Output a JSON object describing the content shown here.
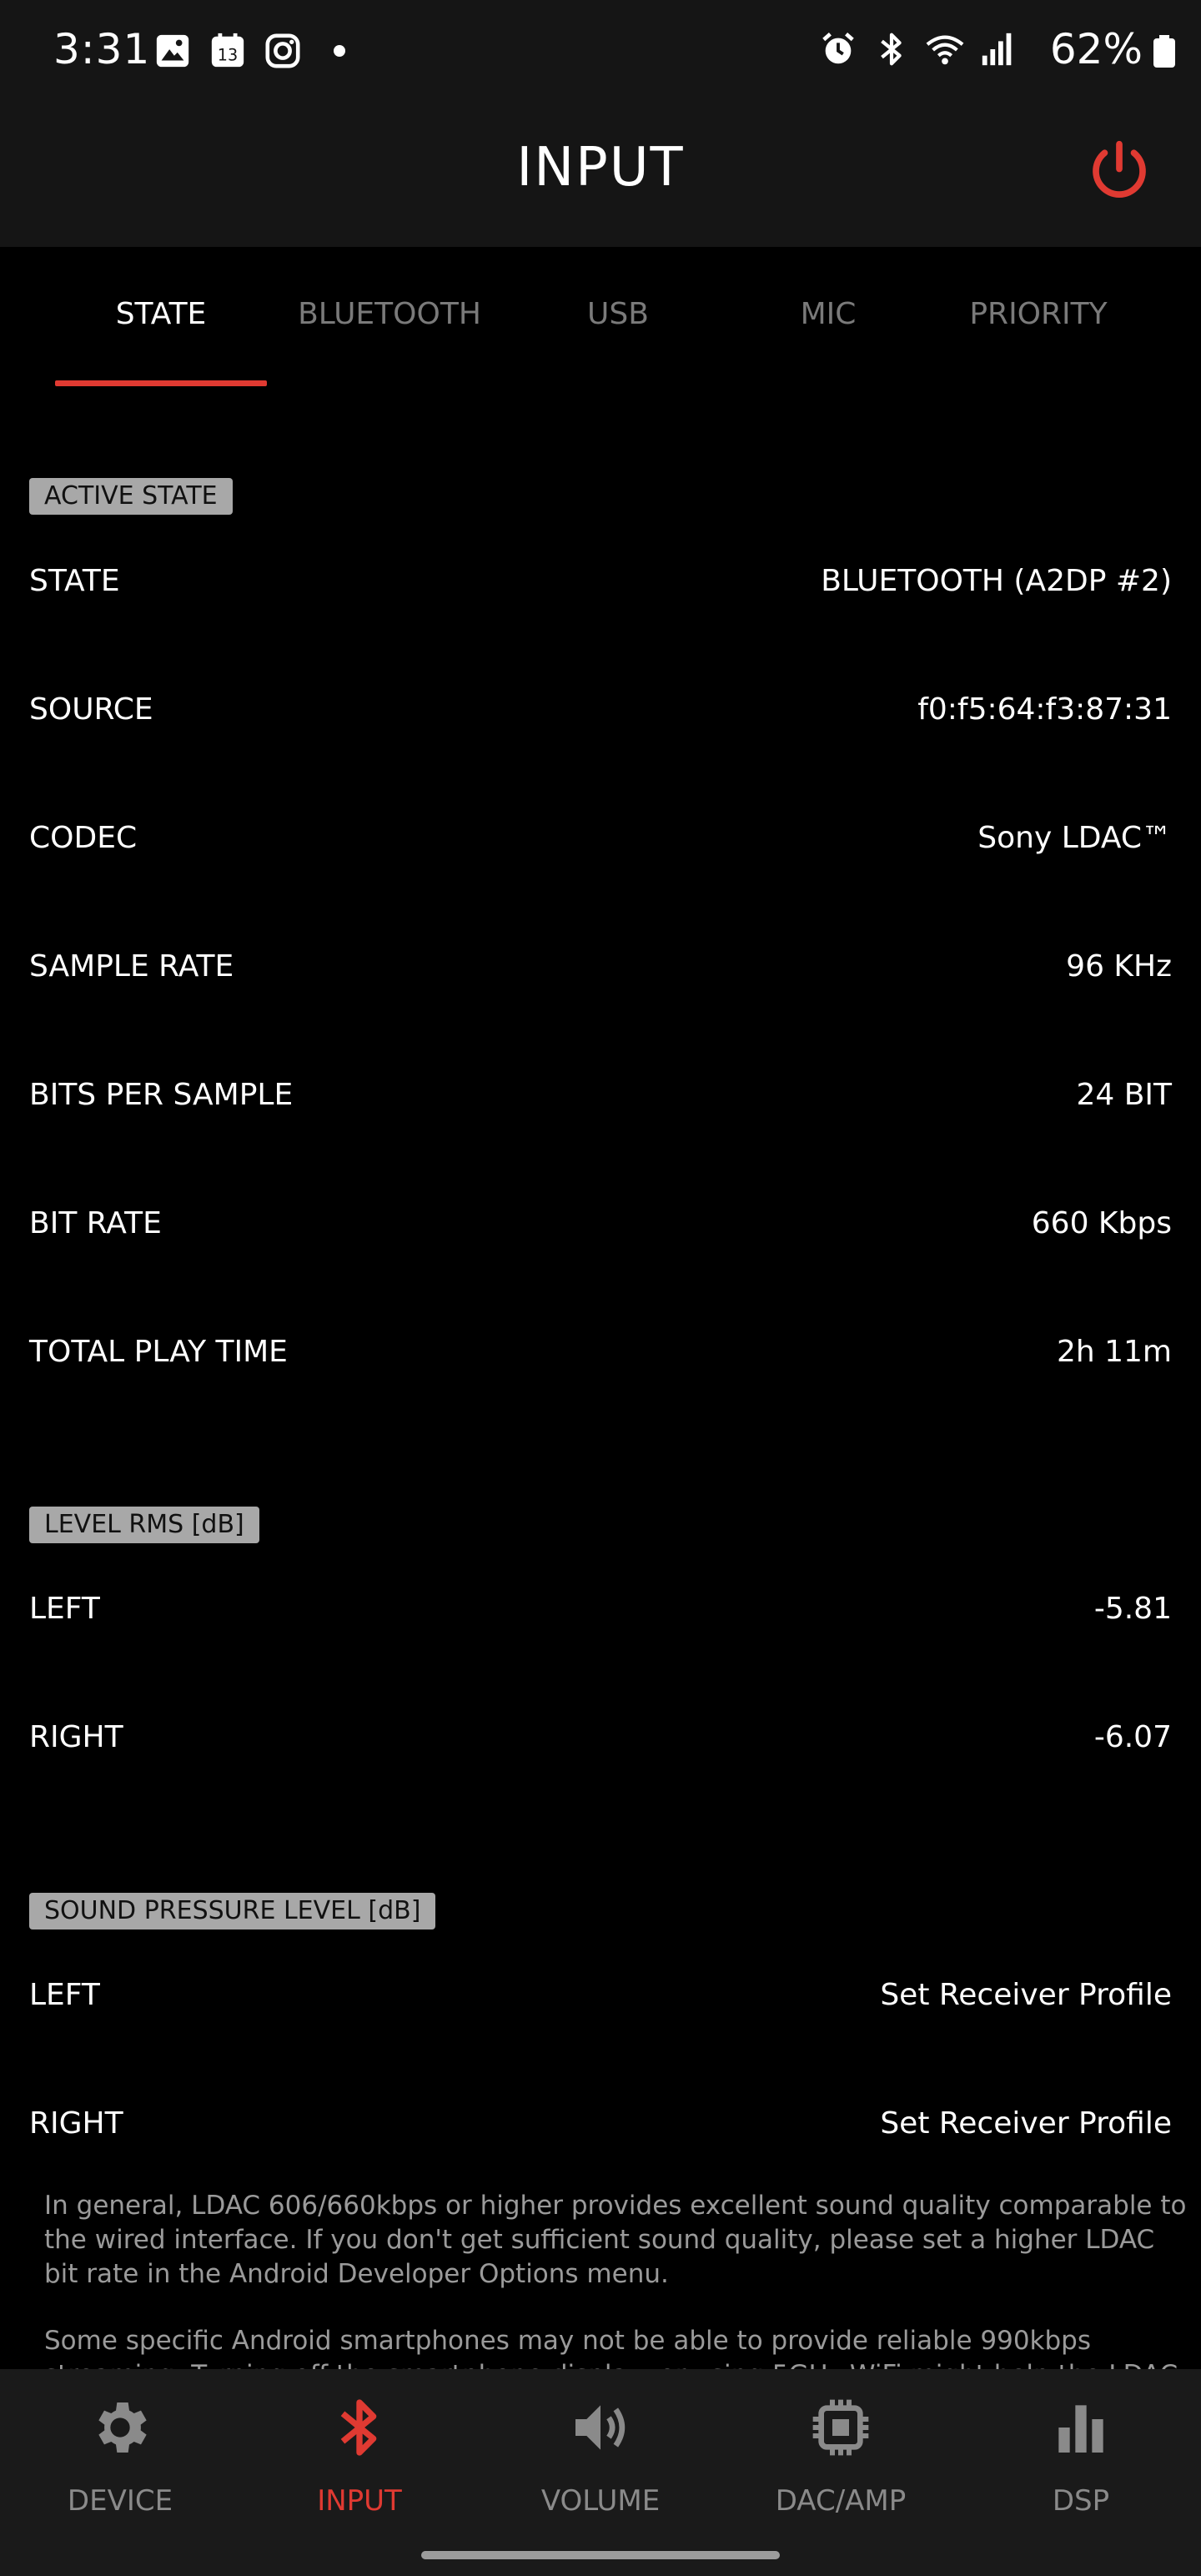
{
  "status_bar": {
    "time": "3:31",
    "battery": "62%",
    "left_icons": [
      "gallery-icon",
      "calendar-icon",
      "instagram-icon",
      "dot-icon"
    ],
    "calendar_day": "13",
    "right_icons": [
      "alarm-icon",
      "bluetooth-icon",
      "wifi-icon",
      "signal-icon",
      "battery-icon"
    ]
  },
  "header": {
    "title": "INPUT",
    "power_icon": "power-icon",
    "accent": "#e03a32"
  },
  "tabs": [
    {
      "label": "STATE",
      "active": true
    },
    {
      "label": "BLUETOOTH",
      "active": false
    },
    {
      "label": "USB",
      "active": false
    },
    {
      "label": "MIC",
      "active": false
    },
    {
      "label": "PRIORITY",
      "active": false
    }
  ],
  "active_state": {
    "badge": "ACTIVE STATE",
    "rows": [
      {
        "label": "STATE",
        "value": "BLUETOOTH (A2DP #2)"
      },
      {
        "label": "SOURCE",
        "value": "f0:f5:64:f3:87:31"
      },
      {
        "label": "CODEC",
        "value": "Sony LDAC™"
      },
      {
        "label": "SAMPLE RATE",
        "value": "96 KHz"
      },
      {
        "label": "BITS PER SAMPLE",
        "value": "24 BIT"
      },
      {
        "label": "BIT RATE",
        "value": "660 Kbps"
      },
      {
        "label": "TOTAL PLAY TIME",
        "value": "2h 11m"
      }
    ]
  },
  "level_rms": {
    "badge": "LEVEL RMS [dB]",
    "rows": [
      {
        "label": "LEFT",
        "value": "-5.81"
      },
      {
        "label": "RIGHT",
        "value": "-6.07"
      }
    ]
  },
  "sound_pressure": {
    "badge": "SOUND PRESSURE LEVEL [dB]",
    "rows": [
      {
        "label": "LEFT",
        "value": "Set Receiver Profile"
      },
      {
        "label": "RIGHT",
        "value": "Set Receiver Profile"
      }
    ]
  },
  "notes": [
    "In general, LDAC 606/660kbps or higher provides excellent sound quality comparable to the wired interface. If you don't get sufficient sound quality, please set a higher LDAC bit rate in the Android Developer Options menu.",
    "Some specific Android smartphones may not be able to provide reliable 990kbps streaming. Turning off the smartphone display, or using 5GHz WiFi might help the LDAC stream and a"
  ],
  "bottom_nav": [
    {
      "label": "DEVICE",
      "icon": "gear-icon",
      "active": false
    },
    {
      "label": "INPUT",
      "icon": "bluetooth-icon",
      "active": true
    },
    {
      "label": "VOLUME",
      "icon": "speaker-icon",
      "active": false
    },
    {
      "label": "DAC/AMP",
      "icon": "chip-icon",
      "active": false
    },
    {
      "label": "DSP",
      "icon": "bar-chart-icon",
      "active": false
    }
  ]
}
